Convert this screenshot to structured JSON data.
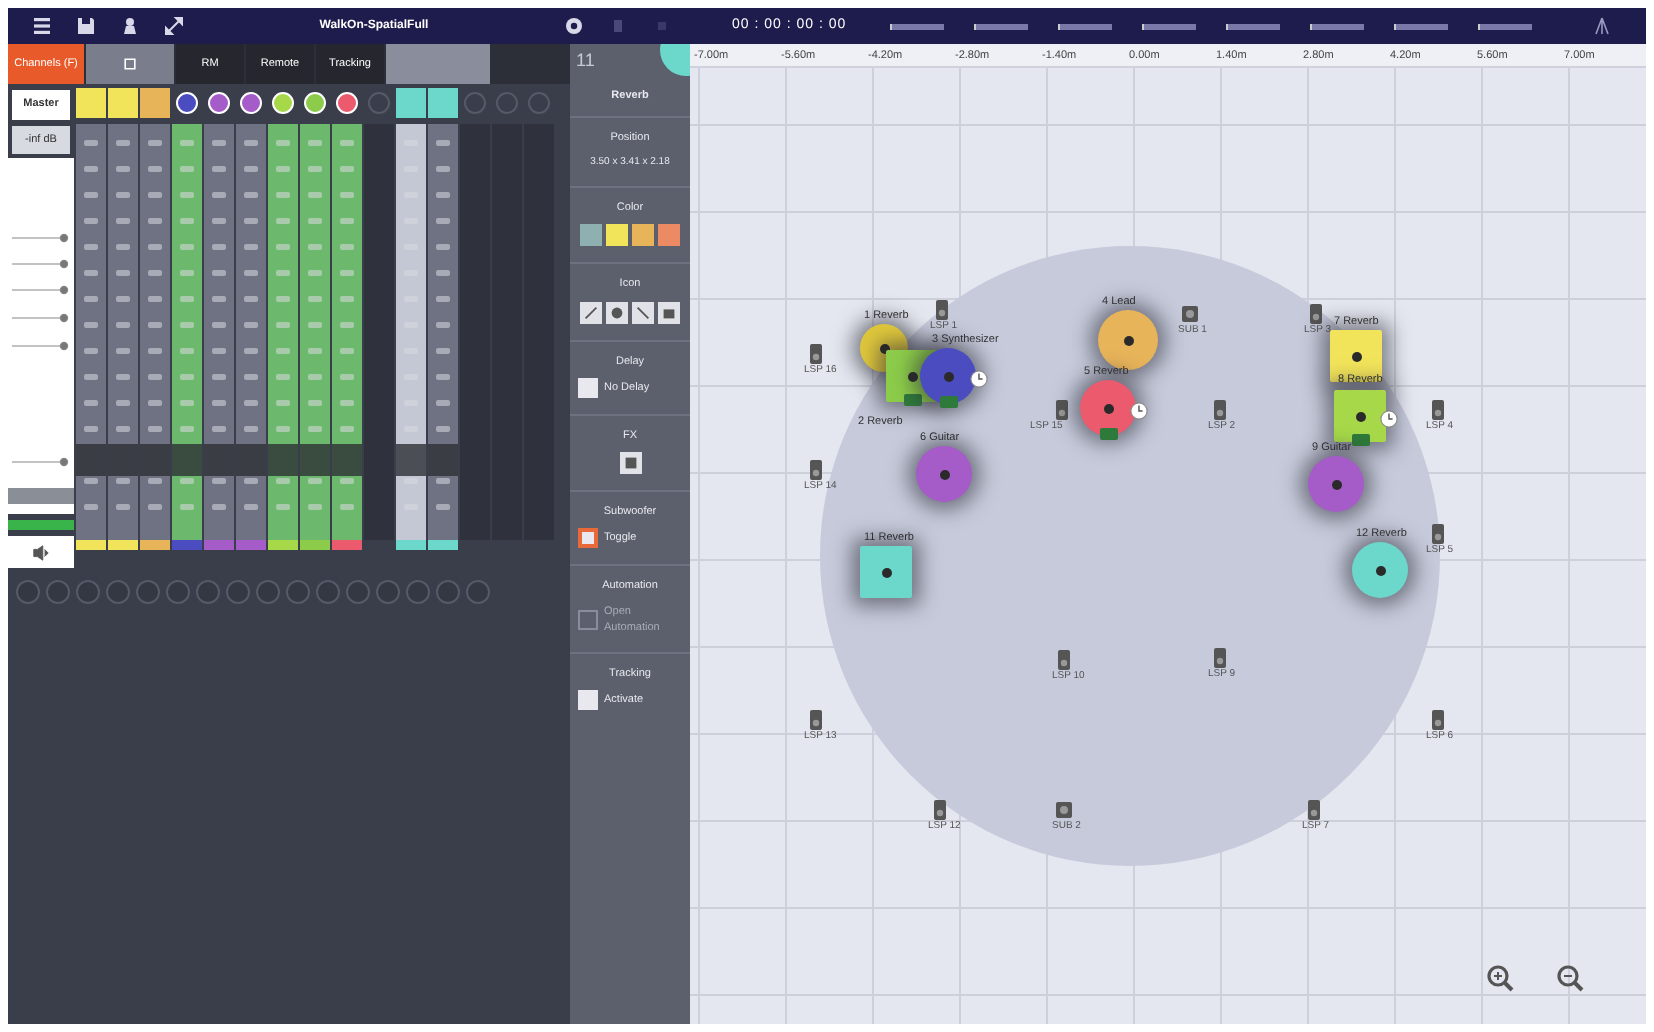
{
  "toolbar": {
    "title": "WalkOn-SpatialFull",
    "timecode": "00 : 00 : 00 : 00"
  },
  "tabs": [
    {
      "kind": "text",
      "label": "Channels (F)",
      "selected": true
    },
    {
      "kind": "icon",
      "selected": false
    },
    {
      "kind": "text",
      "label": "RM",
      "selected": false
    },
    {
      "kind": "text",
      "label": "Remote",
      "selected": false
    },
    {
      "kind": "text",
      "label": "Tracking",
      "selected": false
    },
    {
      "kind": "blank",
      "selected": false
    }
  ],
  "master": {
    "label": "Master",
    "gain": "-inf dB"
  },
  "channels": [
    {
      "kind": "plain",
      "round": false,
      "color": "#f2e45a"
    },
    {
      "kind": "plain",
      "round": false,
      "color": "#f2e45a"
    },
    {
      "kind": "plain",
      "round": false,
      "color": "#e8b45a"
    },
    {
      "kind": "grouped",
      "round": true,
      "color": "#4a4cc0"
    },
    {
      "kind": "plain",
      "round": true,
      "color": "#a65cc8"
    },
    {
      "kind": "plain",
      "round": true,
      "color": "#a65cc8"
    },
    {
      "kind": "grouped",
      "round": true,
      "color": "#a6d84a"
    },
    {
      "kind": "grouped",
      "round": true,
      "color": "#8ccc4a"
    },
    {
      "kind": "grouped",
      "round": true,
      "color": "#ec5a6e"
    },
    {
      "kind": "empty"
    },
    {
      "kind": "selected",
      "round": false,
      "color": "#6cd8cc"
    },
    {
      "kind": "plain",
      "round": false,
      "color": "#6cd8cc"
    },
    {
      "kind": "empty"
    },
    {
      "kind": "empty"
    },
    {
      "kind": "empty"
    }
  ],
  "inspector": {
    "channel_number": "11",
    "title": "Reverb",
    "sections": [
      {
        "kind": "position",
        "heading": "Position",
        "value": "3.50 x 3.41 x 2.18"
      },
      {
        "kind": "colors",
        "heading": "Color",
        "swatches": [
          {
            "color": "#8fb0b0",
            "selected": false
          },
          {
            "color": "#f2e45a",
            "selected": false
          },
          {
            "color": "#e8b45a",
            "selected": false
          },
          {
            "color": "#ec8a64",
            "selected": false
          }
        ]
      },
      {
        "kind": "icons",
        "heading": "Icon"
      },
      {
        "kind": "check",
        "heading": "Delay",
        "label": "No Delay",
        "checked": false,
        "disabled": false
      },
      {
        "kind": "fx",
        "heading": "FX"
      },
      {
        "kind": "check",
        "heading": "Subwoofer",
        "label": "Toggle",
        "checked": true,
        "disabled": false
      },
      {
        "kind": "check",
        "heading": "Automation",
        "label": "Open Automation",
        "checked": false,
        "disabled": true
      },
      {
        "kind": "check",
        "heading": "Tracking",
        "label": "Activate",
        "checked": false,
        "disabled": false
      }
    ]
  },
  "canvas": {
    "ruler": [
      "-7.00m",
      "-5.60m",
      "-4.20m",
      "-2.80m",
      "-1.40m",
      "0.00m",
      "1.40m",
      "2.80m",
      "4.20m",
      "5.60m",
      "7.00m"
    ],
    "sources": [
      {
        "label": "1 Reverb",
        "round": true,
        "color": "#e0c83c"
      },
      {
        "label": "2 Reverb",
        "round": false,
        "color": "#8ccc4a",
        "tag": true
      },
      {
        "label": "3 Synthesizer",
        "round": true,
        "color": "#4a4cc0",
        "tag": true,
        "timer": true
      },
      {
        "label": "4 Lead",
        "round": true,
        "color": "#e8b45a"
      },
      {
        "label": "5 Reverb",
        "round": true,
        "color": "#ec5a6e",
        "tag": true,
        "timer": true
      },
      {
        "label": "6 Guitar",
        "round": true,
        "color": "#a65cc8"
      },
      {
        "label": "7 Reverb",
        "round": false,
        "color": "#f2e45a"
      },
      {
        "label": "8 Reverb",
        "round": false,
        "color": "#a6d84a",
        "tag": true,
        "timer": true
      },
      {
        "label": "9 Guitar",
        "round": true,
        "color": "#a65cc8"
      },
      {
        "label": "11 Reverb",
        "round": false,
        "color": "#6cd8cc"
      },
      {
        "label": "12 Reverb",
        "round": true,
        "color": "#6cd8cc"
      }
    ],
    "speakers": [
      {
        "label": "LSP 16",
        "kind": "speaker"
      },
      {
        "label": "LSP 1",
        "kind": "speaker"
      },
      {
        "label": "LSP 15",
        "kind": "speaker"
      },
      {
        "label": "SUB 1",
        "kind": "sub"
      },
      {
        "label": "LSP 2",
        "kind": "speaker"
      },
      {
        "label": "LSP 3",
        "kind": "speaker"
      },
      {
        "label": "LSP 4",
        "kind": "speaker"
      },
      {
        "label": "LSP 14",
        "kind": "speaker"
      },
      {
        "label": "LSP 5",
        "kind": "speaker"
      },
      {
        "label": "LSP 10",
        "kind": "speaker"
      },
      {
        "label": "LSP 9",
        "kind": "speaker"
      },
      {
        "label": "LSP 13",
        "kind": "speaker"
      },
      {
        "label": "LSP 6",
        "kind": "speaker"
      },
      {
        "label": "LSP 12",
        "kind": "speaker"
      },
      {
        "label": "SUB 2",
        "kind": "sub"
      },
      {
        "label": "LSP 7",
        "kind": "speaker"
      }
    ]
  }
}
